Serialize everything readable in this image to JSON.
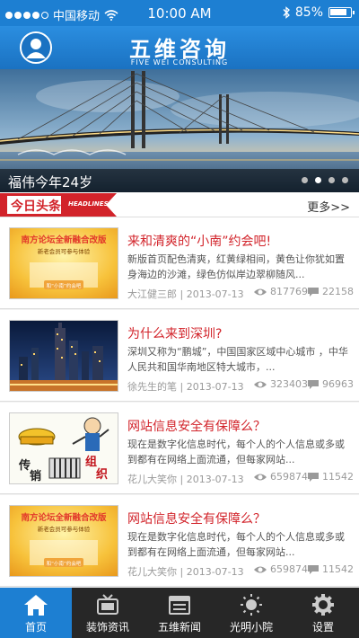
{
  "status_bar": {
    "carrier": "中国移动",
    "time": "10:00 AM",
    "battery": "85%",
    "battery_level": 0.85
  },
  "header": {
    "title": "五维咨询",
    "subtitle": "FIVE WEI CONSULTING"
  },
  "banner": {
    "caption": "福伟今年24岁",
    "page_count": 4,
    "active_page": 1
  },
  "headlines": {
    "title": "今日头条",
    "title_en": "HEADLINES",
    "more": "更多>>"
  },
  "articles": [
    {
      "title": "来和清爽的“小南”约会吧!",
      "summary": "新版首页配色清爽，红黄绿相间，黄色让你犹如置身海边的沙滩，绿色仿似岸边翠柳随风...",
      "author": "大江健三郎",
      "date": "2013-07-13",
      "views": "817769",
      "comments": "22158",
      "thumb": "promo"
    },
    {
      "title": "为什么来到深圳?",
      "summary": "深圳又称为“鹏城”，中国国家区域中心城市 ，中华人民共和国华南地区特大城市，...",
      "author": "徐先生的笔",
      "date": "2013-07-13",
      "views": "323403",
      "comments": "96963",
      "thumb": "city"
    },
    {
      "title": "网站信息安全有保障么？",
      "summary": "现在是数字化信息时代，每个人的个人信息或多或到都有在网络上面流通，但每家网站...",
      "author": "花儿大笑你",
      "date": "2013-07-13",
      "views": "659874",
      "comments": "11542",
      "thumb": "cartoon"
    },
    {
      "title": "网站信息安全有保障么？",
      "summary": "现在是数字化信息时代，每个人的个人信息或多或到都有在网络上面流通，但每家网站...",
      "author": "花儿大笑你",
      "date": "2013-07-13",
      "views": "659874",
      "comments": "11542",
      "thumb": "promo"
    }
  ],
  "promo_thumb": {
    "line1": "南方论坛全新融合改版",
    "line2": "新老会员可参与体验",
    "line3": "和“小南”约会吧"
  },
  "cartoon_thumb": {
    "chars": [
      "传",
      "销",
      "组",
      "织"
    ]
  },
  "tabs": [
    {
      "label": "首页",
      "icon": "home-icon",
      "active": true
    },
    {
      "label": "装饰资讯",
      "icon": "tv-icon",
      "active": false
    },
    {
      "label": "五维新闻",
      "icon": "news-icon",
      "active": false
    },
    {
      "label": "光明小院",
      "icon": "sun-icon",
      "active": false
    },
    {
      "label": "设置",
      "icon": "gear-icon",
      "active": false
    }
  ],
  "colors": {
    "primary": "#1d7fd2",
    "headline_red": "#d2232a",
    "tabbar": "#272727"
  }
}
